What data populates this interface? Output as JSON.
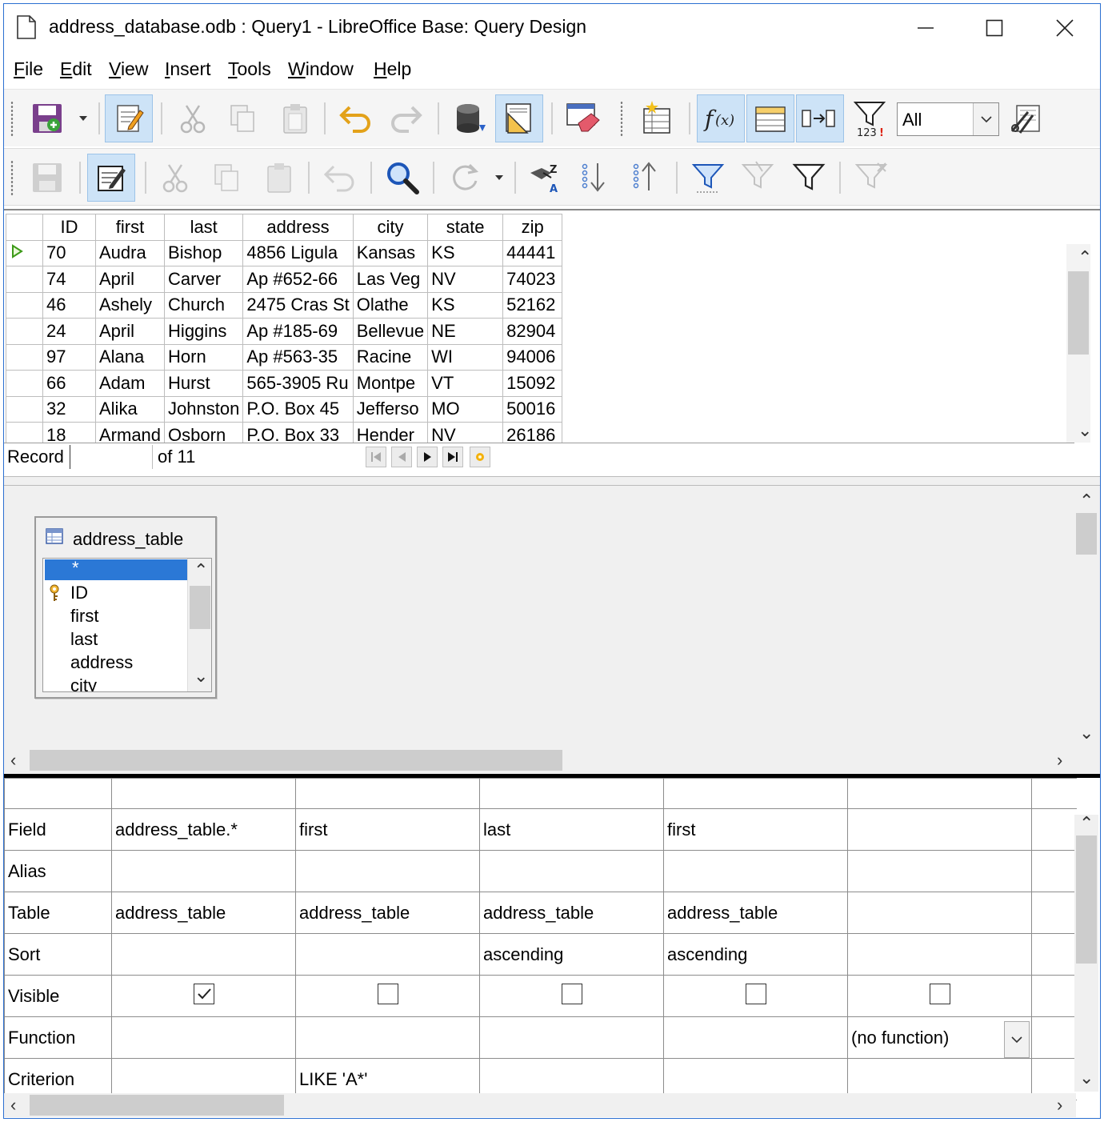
{
  "window": {
    "title": "address_database.odb : Query1 - LibreOffice Base: Query Design"
  },
  "menubar": [
    {
      "label": "File",
      "key": "F",
      "rest": "ile"
    },
    {
      "label": "Edit",
      "key": "E",
      "rest": "dit"
    },
    {
      "label": "View",
      "key": "V",
      "rest": "iew"
    },
    {
      "label": "Insert",
      "key": "I",
      "rest": "nsert"
    },
    {
      "label": "Tools",
      "key": "T",
      "rest": "ools"
    },
    {
      "label": "Window",
      "key": "W",
      "rest": "indow"
    },
    {
      "label": "Help",
      "key": "H",
      "rest": "elp"
    }
  ],
  "toolbar": {
    "limit_value": "All",
    "limit_icon_text": "123"
  },
  "grid": {
    "columns": [
      "ID",
      "first",
      "last",
      "address",
      "city",
      "state",
      "zip"
    ],
    "rows": [
      [
        "70",
        "Audra",
        "Bishop",
        "4856 Ligula",
        "Kansas",
        "KS",
        "44441"
      ],
      [
        "74",
        "April",
        "Carver",
        "Ap #652-66",
        "Las Veg",
        "NV",
        "74023"
      ],
      [
        "46",
        "Ashely",
        "Church",
        "2475 Cras St",
        "Olathe",
        "KS",
        "52162"
      ],
      [
        "24",
        "April",
        "Higgins",
        "Ap #185-69",
        "Bellevue",
        "NE",
        "82904"
      ],
      [
        "97",
        "Alana",
        "Horn",
        "Ap #563-35",
        "Racine",
        "WI",
        "94006"
      ],
      [
        "66",
        "Adam",
        "Hurst",
        "565-3905 Ru",
        "Montpe",
        "VT",
        "15092"
      ],
      [
        "32",
        "Alika",
        "Johnston",
        "P.O. Box 45",
        "Jefferso",
        "MO",
        "50016"
      ],
      [
        "18",
        "Armand",
        "Osborn",
        "P.O. Box 33",
        "Hender",
        "NV",
        "26186"
      ]
    ],
    "record_label": "Record",
    "record_value": "",
    "record_of": "of 11"
  },
  "table_window": {
    "title": "address_table",
    "fields": [
      "*",
      "ID",
      "first",
      "last",
      "address",
      "city"
    ]
  },
  "criteria": {
    "row_labels": [
      "Field",
      "Alias",
      "Table",
      "Sort",
      "Visible",
      "Function",
      "Criterion"
    ],
    "columns": [
      {
        "field": "address_table.*",
        "alias": "",
        "table": "address_table",
        "sort": "",
        "visible": true,
        "function": "",
        "criterion": ""
      },
      {
        "field": "first",
        "alias": "",
        "table": "address_table",
        "sort": "",
        "visible": false,
        "function": "",
        "criterion": "LIKE 'A*'"
      },
      {
        "field": "last",
        "alias": "",
        "table": "address_table",
        "sort": "ascending",
        "visible": false,
        "function": "",
        "criterion": ""
      },
      {
        "field": "first",
        "alias": "",
        "table": "address_table",
        "sort": "ascending",
        "visible": false,
        "function": "",
        "criterion": ""
      },
      {
        "field": "",
        "alias": "",
        "table": "",
        "sort": "",
        "visible": false,
        "function": "(no function)",
        "criterion": ""
      }
    ]
  }
}
